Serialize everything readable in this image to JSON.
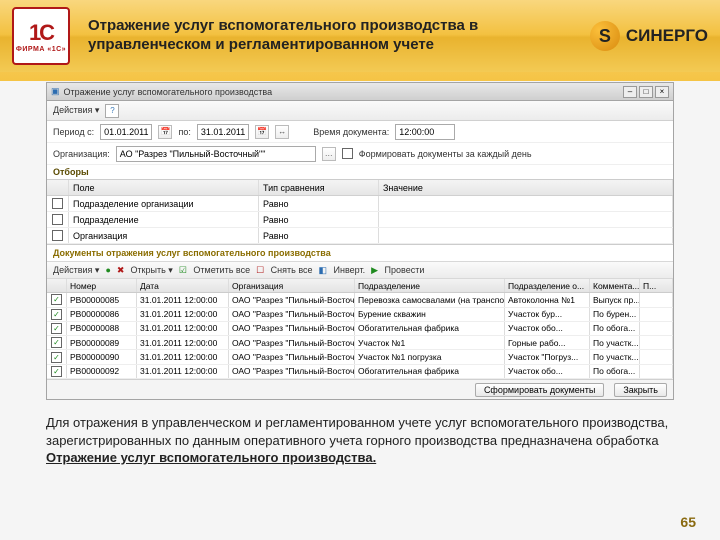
{
  "header": {
    "slide_title": "Отражение услуг вспомогательного производства в управленческом и регламентированном учете",
    "logo1c_big": "1С",
    "logo1c_small": "ФИРМА «1С»",
    "sinergo_glyph": "S",
    "sinergo_text": "СИНЕРГО"
  },
  "app": {
    "title": "Отражение услуг вспомогательного производства",
    "actions_label": "Действия ▾",
    "period_label": "Период с:",
    "period_from": "01.01.2011",
    "period_to_label": "по:",
    "period_to": "31.01.2011",
    "time_label": "Время документа:",
    "time_value": "12:00:00",
    "org_label": "Организация:",
    "org_value": "АО \"Разрез \"Пильный-Восточный\"\"",
    "form_each_day": "Формировать документы за каждый день",
    "filters_title": "Отборы",
    "filters_head": {
      "c0": "",
      "c1": "Поле",
      "c2": "Тип сравнения",
      "c3": "Значение"
    },
    "filters_rows": [
      {
        "c1": "Подразделение организации",
        "c2": "Равно",
        "c3": ""
      },
      {
        "c1": "Подразделение",
        "c2": "Равно",
        "c3": ""
      },
      {
        "c1": "Организация",
        "c2": "Равно",
        "c3": ""
      }
    ],
    "docs_title": "Документы отражения услуг вспомогательного производства",
    "docs_toolbar": {
      "actions": "Действия ▾",
      "open": "Открыть ▾",
      "markall": "Отметить все",
      "unmarkall": "Снять все",
      "invert": "Инверт.",
      "do": "Провести"
    },
    "docs_head": {
      "c0": "",
      "c1": "Номер",
      "c2": "Дата",
      "c3": "Организация",
      "c4": "Подразделение",
      "c5": "Подразделение о...",
      "c6": "Коммента...",
      "c7": "П..."
    },
    "docs_rows": [
      {
        "n": "РВ00000085",
        "d": "31.01.2011 12:00:00",
        "o": "ОАО \"Разрез \"Пильный-Восточный\"\"",
        "p": "Перевозка самосвалами (на транспортно...",
        "p2": "Автоколонна №1",
        "k": "Выпуск пр..."
      },
      {
        "n": "РВ00000086",
        "d": "31.01.2011 12:00:00",
        "o": "ОАО \"Разрез \"Пильный-Восточный\"\"",
        "p": "Бурение скважин",
        "p2": "Участок бур...",
        "k": "По бурен..."
      },
      {
        "n": "РВ00000088",
        "d": "31.01.2011 12:00:00",
        "o": "ОАО \"Разрез \"Пильный-Восточный\"\"",
        "p": "Обогатительная фабрика",
        "p2": "Участок обо...",
        "k": "По обога..."
      },
      {
        "n": "РВ00000089",
        "d": "31.01.2011 12:00:00",
        "o": "ОАО \"Разрез \"Пильный-Восточный\"\"",
        "p": "Участок №1",
        "p2": "Горные рабо...",
        "k": "По участк..."
      },
      {
        "n": "РВ00000090",
        "d": "31.01.2011 12:00:00",
        "o": "ОАО \"Разрез \"Пильный-Восточный\"\"",
        "p": "Участок №1 погрузка",
        "p2": "Участок \"Погруз...",
        "k": "По участк..."
      },
      {
        "n": "РВ00000092",
        "d": "31.01.2011 12:00:00",
        "o": "ОАО \"Разрез \"Пильный-Восточный\"\"",
        "p": "Обогатительная фабрика",
        "p2": "Участок обо...",
        "k": "По обога..."
      }
    ],
    "footer": {
      "form_docs": "Сформировать документы",
      "close": "Закрыть"
    }
  },
  "body_text": {
    "p1a": "Для отражения в управленческом и регламентированном учете услуг вспомогательного производства, зарегистрированных по данным оперативного учета горного производства предназначена обработка",
    "p1b": "Отражение услуг вспомогательного производства."
  },
  "page_number": "65"
}
